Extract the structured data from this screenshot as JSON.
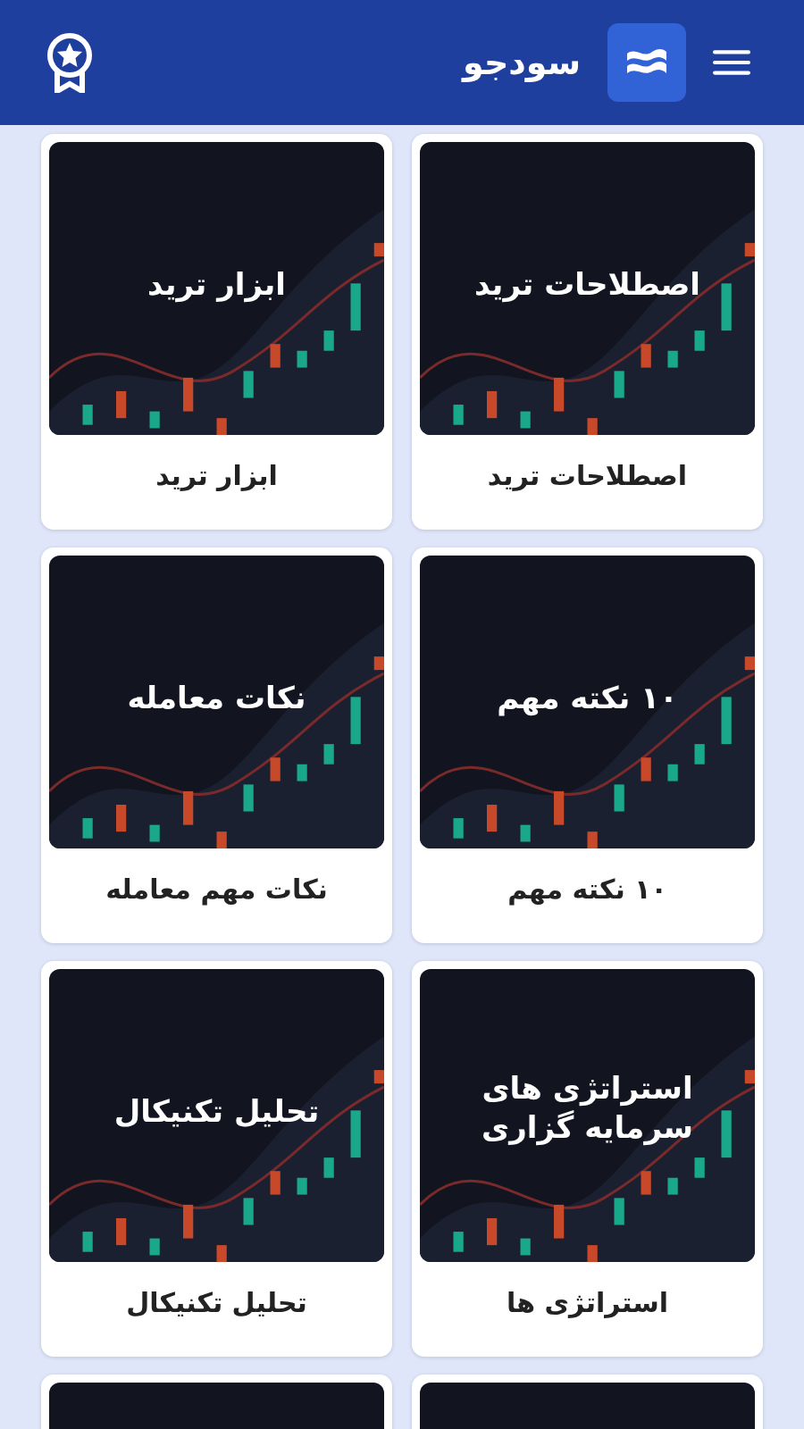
{
  "header": {
    "app_name": "سودجو"
  },
  "cards": [
    {
      "kind": "article",
      "image_title": "اصطلاحات ترید",
      "caption": "اصطلاحات ترید"
    },
    {
      "kind": "article",
      "image_title": "ابزار ترید",
      "caption": "ابزار ترید"
    },
    {
      "kind": "article",
      "image_title": "۱۰ نکته مهم",
      "caption": "۱۰ نکته مهم"
    },
    {
      "kind": "article",
      "image_title": "نکات معامله",
      "caption": "نکات مهم معامله"
    },
    {
      "kind": "article",
      "image_title": "استراتژی های سرمایه گزاری",
      "caption": "استراتژی ها"
    },
    {
      "kind": "article",
      "image_title": "تحلیل تکنیکال",
      "caption": "تحلیل تکنیکال"
    },
    {
      "kind": "picture"
    },
    {
      "kind": "picture"
    }
  ]
}
